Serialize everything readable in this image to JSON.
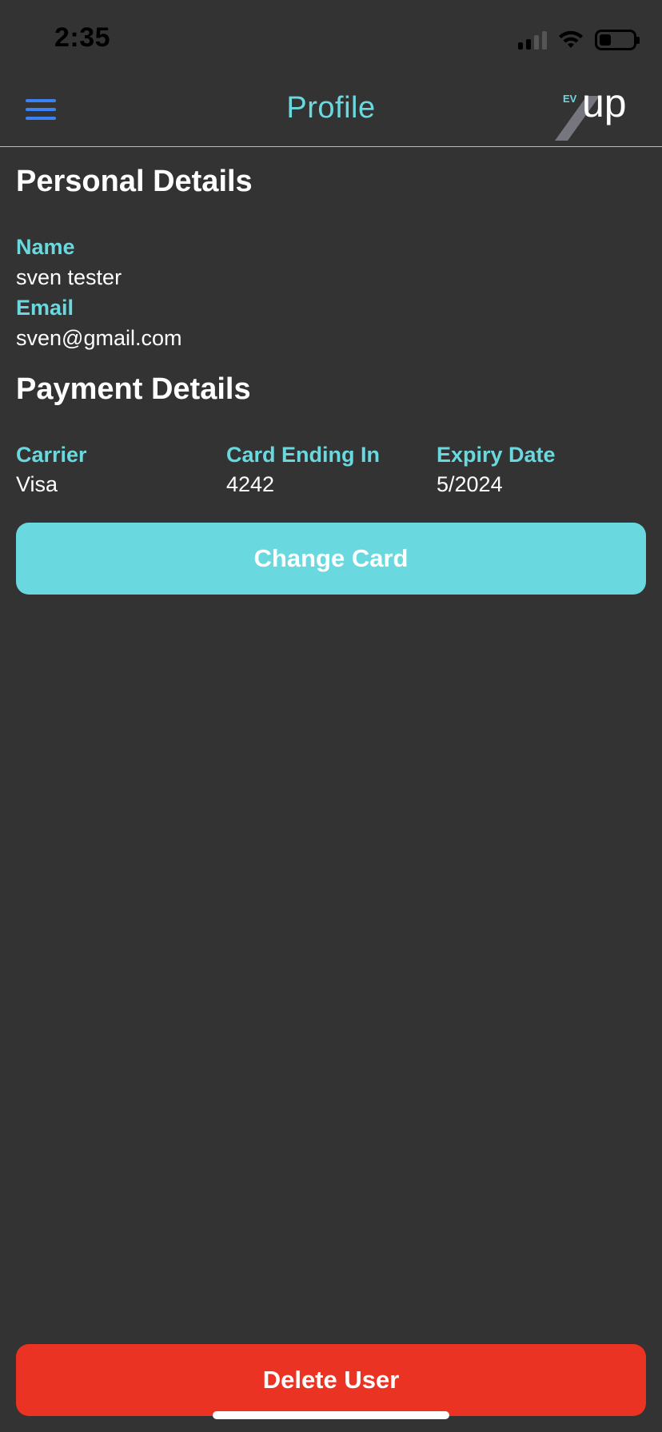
{
  "status_bar": {
    "time": "2:35",
    "battery_level": 0.35
  },
  "header": {
    "title": "Profile",
    "logo_small_text": "EV",
    "logo_main_text": "up"
  },
  "personal": {
    "section_title": "Personal Details",
    "name_label": "Name",
    "name_value": "sven tester",
    "email_label": "Email",
    "email_value": "sven@gmail.com"
  },
  "payment": {
    "section_title": "Payment Details",
    "carrier_label": "Carrier",
    "carrier_value": "Visa",
    "card_ending_label": "Card Ending In",
    "card_ending_value": "4242",
    "expiry_label": "Expiry Date",
    "expiry_value": "5/2024",
    "change_card_label": "Change Card"
  },
  "footer": {
    "delete_user_label": "Delete User"
  },
  "colors": {
    "background": "#333333",
    "accent": "#6ad9df",
    "menu_icon": "#3b82f6",
    "danger": "#ea3323"
  },
  "icons": {
    "menu": "hamburger-menu-icon",
    "signal": "cellular-signal-icon",
    "wifi": "wifi-icon",
    "battery": "battery-icon"
  }
}
